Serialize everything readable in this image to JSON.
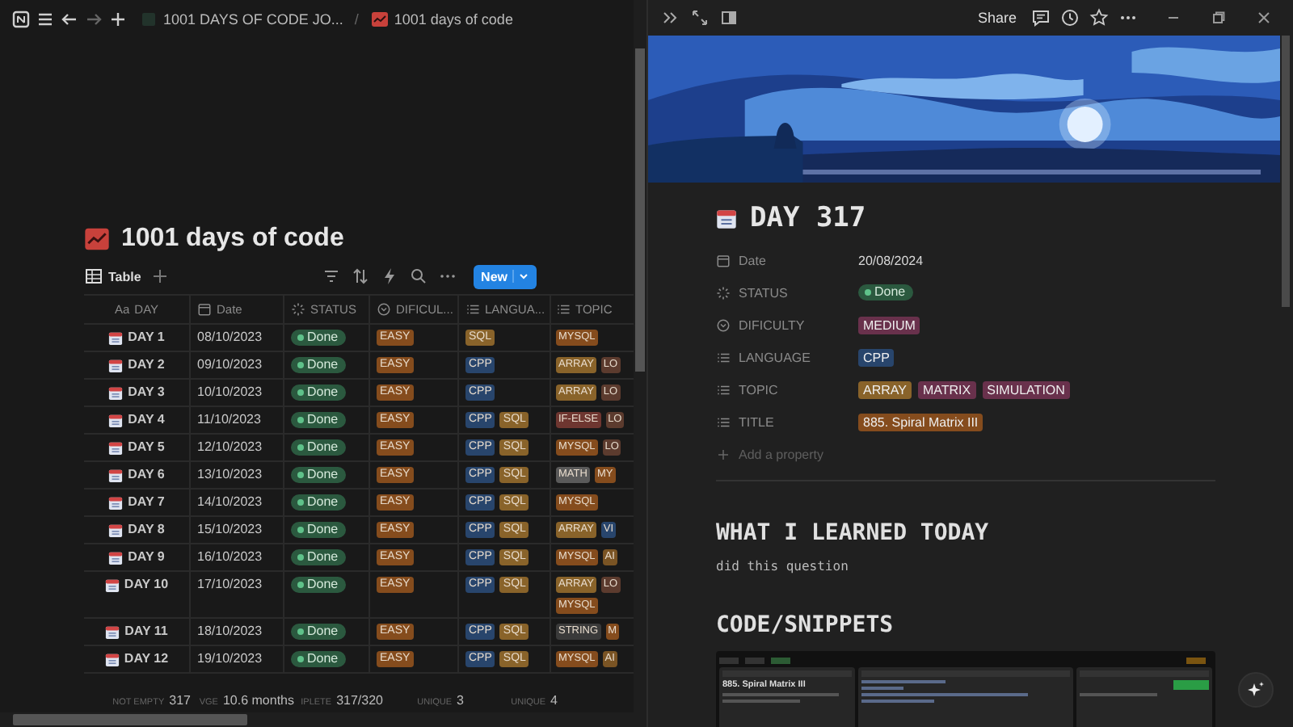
{
  "breadcrumbs": [
    {
      "text": "1001 DAYS OF CODE JO..."
    },
    {
      "text": "1001 days of code"
    }
  ],
  "breadcrumb_separator": "/",
  "share": "Share",
  "database": {
    "title": "1001 days of code",
    "view_tab": "Table",
    "new_button": "New",
    "columns": [
      {
        "name": "DAY",
        "kind": "title",
        "glyph": "Aa"
      },
      {
        "name": "Date",
        "kind": "date"
      },
      {
        "name": "STATUS",
        "kind": "status"
      },
      {
        "name": "DIFICUL...",
        "kind": "select"
      },
      {
        "name": "LANGUA...",
        "kind": "multi_select"
      },
      {
        "name": "TOPIC",
        "kind": "multi_select"
      }
    ],
    "rows": [
      {
        "day": "DAY 1",
        "date": "08/10/2023",
        "status": "Done",
        "difficulty": {
          "text": "EASY",
          "color": "#854c1d"
        },
        "languages": [
          {
            "text": "SQL",
            "color": "#89632a"
          }
        ],
        "topics": [
          {
            "text": "MYSQL",
            "color": "#854c1d"
          }
        ]
      },
      {
        "day": "DAY 2",
        "date": "09/10/2023",
        "status": "Done",
        "difficulty": {
          "text": "EASY",
          "color": "#854c1d"
        },
        "languages": [
          {
            "text": "CPP",
            "color": "#28456c"
          }
        ],
        "topics": [
          {
            "text": "ARRAY",
            "color": "#89632a"
          },
          {
            "text": "LO",
            "color": "#5c3b2e"
          }
        ]
      },
      {
        "day": "DAY 3",
        "date": "10/10/2023",
        "status": "Done",
        "difficulty": {
          "text": "EASY",
          "color": "#854c1d"
        },
        "languages": [
          {
            "text": "CPP",
            "color": "#28456c"
          }
        ],
        "topics": [
          {
            "text": "ARRAY",
            "color": "#89632a"
          },
          {
            "text": "LO",
            "color": "#5c3b2e"
          }
        ]
      },
      {
        "day": "DAY 4",
        "date": "11/10/2023",
        "status": "Done",
        "difficulty": {
          "text": "EASY",
          "color": "#854c1d"
        },
        "languages": [
          {
            "text": "CPP",
            "color": "#28456c"
          },
          {
            "text": "SQL",
            "color": "#89632a"
          }
        ],
        "topics": [
          {
            "text": "IF-ELSE",
            "color": "#6e3630"
          },
          {
            "text": "LO",
            "color": "#5c3b2e"
          }
        ]
      },
      {
        "day": "DAY 5",
        "date": "12/10/2023",
        "status": "Done",
        "difficulty": {
          "text": "EASY",
          "color": "#854c1d"
        },
        "languages": [
          {
            "text": "CPP",
            "color": "#28456c"
          },
          {
            "text": "SQL",
            "color": "#89632a"
          }
        ],
        "topics": [
          {
            "text": "MYSQL",
            "color": "#854c1d"
          },
          {
            "text": "LO",
            "color": "#5c3b2e"
          }
        ]
      },
      {
        "day": "DAY 6",
        "date": "13/10/2023",
        "status": "Done",
        "difficulty": {
          "text": "EASY",
          "color": "#854c1d"
        },
        "languages": [
          {
            "text": "CPP",
            "color": "#28456c"
          },
          {
            "text": "SQL",
            "color": "#89632a"
          }
        ],
        "topics": [
          {
            "text": "MATH",
            "color": "#5a5a5a"
          },
          {
            "text": "MY",
            "color": "#854c1d"
          }
        ]
      },
      {
        "day": "DAY 7",
        "date": "14/10/2023",
        "status": "Done",
        "difficulty": {
          "text": "EASY",
          "color": "#854c1d"
        },
        "languages": [
          {
            "text": "CPP",
            "color": "#28456c"
          },
          {
            "text": "SQL",
            "color": "#89632a"
          }
        ],
        "topics": [
          {
            "text": "MYSQL",
            "color": "#854c1d"
          }
        ]
      },
      {
        "day": "DAY 8",
        "date": "15/10/2023",
        "status": "Done",
        "difficulty": {
          "text": "EASY",
          "color": "#854c1d"
        },
        "languages": [
          {
            "text": "CPP",
            "color": "#28456c"
          },
          {
            "text": "SQL",
            "color": "#89632a"
          }
        ],
        "topics": [
          {
            "text": "ARRAY",
            "color": "#89632a"
          },
          {
            "text": "VI",
            "color": "#28456c"
          }
        ]
      },
      {
        "day": "DAY 9",
        "date": "16/10/2023",
        "status": "Done",
        "difficulty": {
          "text": "EASY",
          "color": "#854c1d"
        },
        "languages": [
          {
            "text": "CPP",
            "color": "#28456c"
          },
          {
            "text": "SQL",
            "color": "#89632a"
          }
        ],
        "topics": [
          {
            "text": "MYSQL",
            "color": "#854c1d"
          },
          {
            "text": "AI",
            "color": "#7a5424"
          }
        ]
      },
      {
        "day": "DAY 10",
        "date": "17/10/2023",
        "status": "Done",
        "difficulty": {
          "text": "EASY",
          "color": "#854c1d"
        },
        "languages": [
          {
            "text": "CPP",
            "color": "#28456c"
          },
          {
            "text": "SQL",
            "color": "#89632a"
          }
        ],
        "topics": [
          {
            "text": "ARRAY",
            "color": "#89632a"
          },
          {
            "text": "LO",
            "color": "#5c3b2e"
          },
          {
            "text": "MYSQL",
            "color": "#854c1d"
          }
        ]
      },
      {
        "day": "DAY 11",
        "date": "18/10/2023",
        "status": "Done",
        "difficulty": {
          "text": "EASY",
          "color": "#854c1d"
        },
        "languages": [
          {
            "text": "CPP",
            "color": "#28456c"
          },
          {
            "text": "SQL",
            "color": "#89632a"
          }
        ],
        "topics": [
          {
            "text": "STRING",
            "color": "#3a3a3a"
          },
          {
            "text": "M",
            "color": "#854c1d"
          }
        ]
      },
      {
        "day": "DAY 12",
        "date": "19/10/2023",
        "status": "Done",
        "difficulty": {
          "text": "EASY",
          "color": "#854c1d"
        },
        "languages": [
          {
            "text": "CPP",
            "color": "#28456c"
          },
          {
            "text": "SQL",
            "color": "#89632a"
          }
        ],
        "topics": [
          {
            "text": "MYSQL",
            "color": "#854c1d"
          },
          {
            "text": "AI",
            "color": "#7a5424"
          }
        ]
      }
    ],
    "footer": [
      {
        "label": "NOT EMPTY",
        "value": "317"
      },
      {
        "label": "VGE",
        "value": "10.6 months"
      },
      {
        "label": "IPLETE",
        "value": "317/320"
      },
      {
        "label": "UNIQUE",
        "value": "3"
      },
      {
        "label": "UNIQUE",
        "value": "4"
      }
    ]
  },
  "page": {
    "title": "DAY 317",
    "properties": [
      {
        "kind": "date",
        "label": "Date",
        "value": "20/08/2024"
      },
      {
        "kind": "status",
        "label": "STATUS",
        "value": "Done"
      },
      {
        "kind": "select",
        "label": "DIFICULTY",
        "tags": [
          {
            "text": "MEDIUM",
            "color": "#69314c"
          }
        ]
      },
      {
        "kind": "multi_select",
        "label": "LANGUAGE",
        "tags": [
          {
            "text": "CPP",
            "color": "#28456c"
          }
        ]
      },
      {
        "kind": "multi_select",
        "label": "TOPIC",
        "tags": [
          {
            "text": "ARRAY",
            "color": "#89632a"
          },
          {
            "text": "MATRIX",
            "color": "#69314c"
          },
          {
            "text": "SIMULATION",
            "color": "#69314c"
          }
        ]
      },
      {
        "kind": "multi_select",
        "label": "TITLE",
        "tags": [
          {
            "text": "885. Spiral Matrix III",
            "color": "#854c1d"
          }
        ]
      }
    ],
    "add_property": "Add a property",
    "sections": [
      {
        "heading": "WHAT I LEARNED TODAY",
        "text": "did this question"
      },
      {
        "heading": "CODE/SNIPPETS"
      }
    ],
    "snippet_title": "885. Spiral Matrix III"
  }
}
